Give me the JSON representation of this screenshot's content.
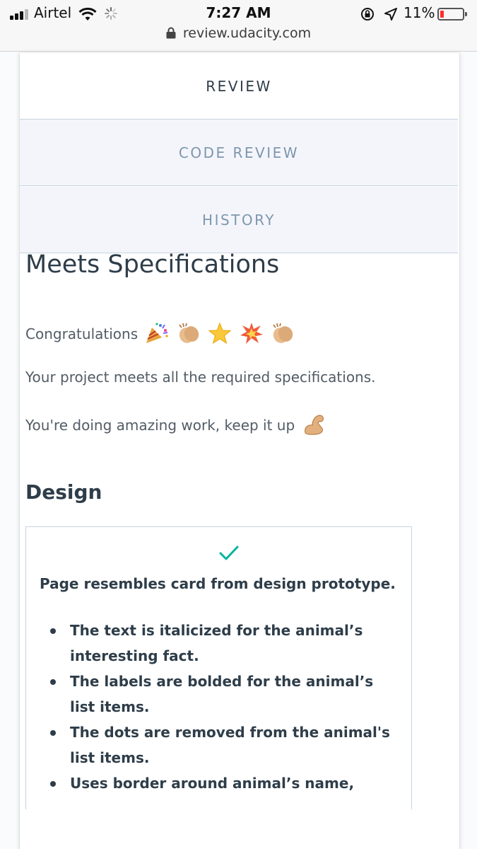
{
  "status_bar": {
    "carrier": "Airtel",
    "time": "7:27 AM",
    "battery_percent": "11%",
    "battery_level": 0.11
  },
  "browser": {
    "url": "review.udacity.com"
  },
  "tabs": [
    {
      "label": "REVIEW",
      "active": true
    },
    {
      "label": "CODE REVIEW",
      "active": false
    },
    {
      "label": "HISTORY",
      "active": false
    }
  ],
  "summary": {
    "title": "Meets Specifications",
    "congrats": "Congratulations",
    "congrats_emojis": [
      "party-popper",
      "clapping-hands",
      "glowing-star",
      "collision",
      "clapping-hands"
    ],
    "line2": "Your project meets all the required specifications.",
    "line3": "You're doing amazing work, keep it up",
    "line3_emoji": "flexed-biceps"
  },
  "section": {
    "title": "Design",
    "rubric": {
      "status": "meets",
      "criterion": "Page resembles card from design prototype.",
      "bullets": [
        "The text is italicized for the animal’s interesting fact.",
        "The labels are bolded for the animal’s list items.",
        "The dots are removed from the animal's list items.",
        "Uses border around animal’s name,"
      ]
    }
  },
  "colors": {
    "text_dark": "#2e3d49",
    "tab_inactive_text": "#7d97ad",
    "tab_inactive_bg": "#f4f5fb",
    "check_green": "#02b3a0"
  }
}
